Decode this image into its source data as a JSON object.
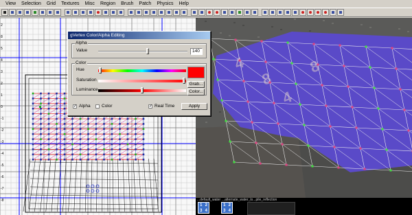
{
  "menu": [
    "View",
    "Selection",
    "Grid",
    "Textures",
    "Misc",
    "Region",
    "Brush",
    "Patch",
    "Physics",
    "Help"
  ],
  "dialog": {
    "title": "gVertex Color/Alpha Editing",
    "alpha_group": "Alpha",
    "value_label": "Value",
    "value": "140",
    "alpha_level": 0.55,
    "color_group": "Color",
    "hue_label": "Hue",
    "saturation_label": "Saturation",
    "luminance_label": "Luminance",
    "hue_level": 0.02,
    "saturation_level": 0.98,
    "luminance_level": 0.5,
    "swatch_color": "#ff0000",
    "grab_button": "Grab...",
    "color_button": "Color...",
    "alpha_checkbox": "Alpha",
    "alpha_checked": true,
    "color_checkbox": "Color",
    "color_checked": false,
    "realtime_checkbox": "Real Time",
    "realtime_checked": true,
    "apply_button": "Apply"
  },
  "textures": {
    "name1": "...default_water",
    "name2": "...alternate_water_lo...pile_reflection",
    "thumb_digits": [
      "1",
      "2",
      "3",
      "4"
    ]
  },
  "grid": {
    "ruler_numbers": [
      "2",
      "8",
      "5",
      "4",
      "3",
      "2",
      "1",
      "0",
      "-1",
      "-2",
      "-3",
      "-4",
      "-5",
      "-6",
      "-7",
      "-8"
    ]
  },
  "colors": {
    "accent": "#0a246a",
    "grid_blue": "#0000ff",
    "patch_red": "#e03030",
    "patch_magenta": "#d020a0",
    "water_purple": "#5a4ac8"
  },
  "camera": {
    "floor_numbers": [
      "4",
      "8"
    ]
  }
}
